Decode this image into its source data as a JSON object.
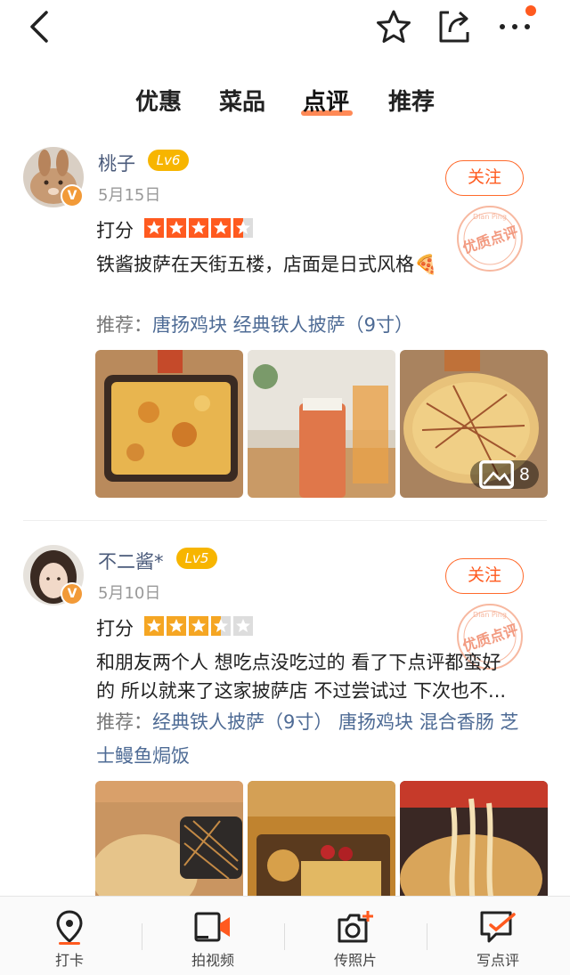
{
  "tabs": [
    "优惠",
    "菜品",
    "点评",
    "推荐"
  ],
  "active_tab": "点评",
  "reviews": [
    {
      "user": "桃子",
      "level": "Lv6",
      "date": "5月15日",
      "follow": "关注",
      "score_label": "打分",
      "rating": 4.5,
      "star_color": "#ff5a1f",
      "text": "铁酱披萨在天街五楼，店面是日式风格🍕",
      "rec_prefix": "推荐：",
      "rec_items": "唐扬鸡块 经典铁人披萨（9寸）",
      "photo_count": "8",
      "stamp": "优质点评"
    },
    {
      "user": "不二酱*",
      "level": "Lv5",
      "date": "5月10日",
      "follow": "关注",
      "score_label": "打分",
      "rating": 3.5,
      "star_color": "#f5a623",
      "text_line1": "和朋友两个人 想吃点没吃过的 看了下点评都蛮好",
      "text_line2": "的 所以就来了这家披萨店 不过尝试过 下次也不...",
      "rec_prefix": "推荐：",
      "rec_items_line1": "经典铁人披萨（9寸） 唐扬鸡块 混合香肠 芝",
      "rec_items_line2": "士鳗鱼焗饭",
      "stamp": "优质点评"
    }
  ],
  "badge_v": "V",
  "stamp_sub": "Dian Ping",
  "bottom_bar": [
    {
      "label": "打卡",
      "icon": "location-pin-icon"
    },
    {
      "label": "拍视频",
      "icon": "video-camera-icon"
    },
    {
      "label": "传照片",
      "icon": "photo-camera-icon"
    },
    {
      "label": "写点评",
      "icon": "write-review-icon"
    }
  ],
  "colors": {
    "accent": "#ff5a1f",
    "link": "#4e6b95",
    "level_badge": "#f7b500"
  }
}
